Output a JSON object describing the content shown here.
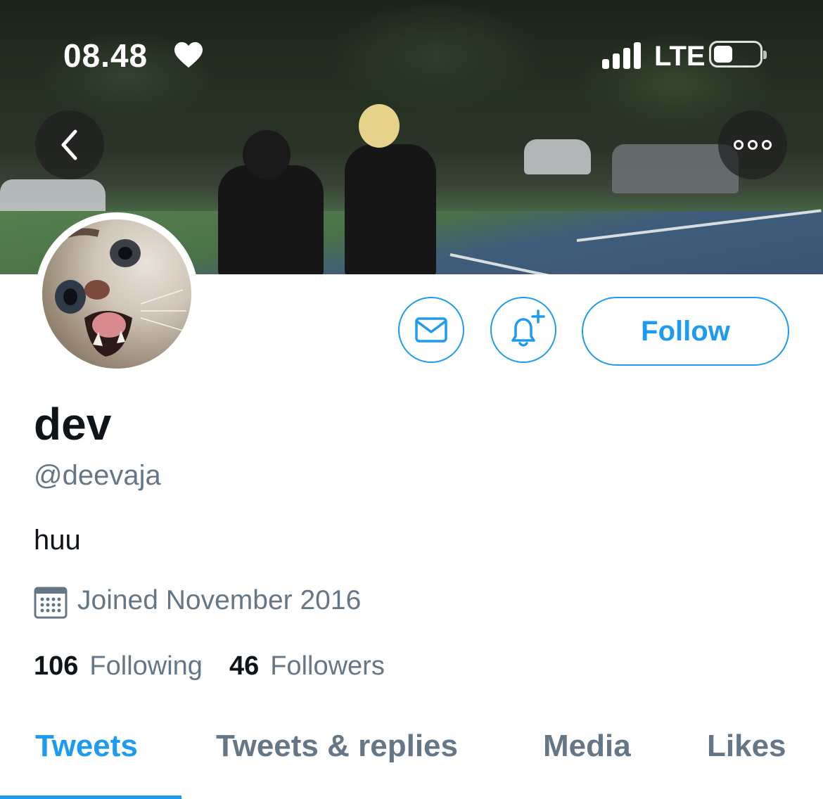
{
  "status_bar": {
    "time": "08.48",
    "network": "LTE"
  },
  "profile": {
    "display_name": "dev",
    "handle": "@deevaja",
    "bio": "huu",
    "joined": "Joined November 2016",
    "following_count": "106",
    "following_label": "Following",
    "followers_count": "46",
    "followers_label": "Followers"
  },
  "actions": {
    "follow_label": "Follow"
  },
  "tabs": [
    {
      "label": "Tweets"
    },
    {
      "label": "Tweets & replies"
    },
    {
      "label": "Media"
    },
    {
      "label": "Likes"
    }
  ],
  "colors": {
    "accent": "#1d9bf0",
    "secondary_text": "#657786",
    "primary_text": "#0f1419"
  },
  "icons": {
    "back": "chevron-left-icon",
    "more": "ellipsis-icon",
    "mail": "mail-icon",
    "notify": "bell-plus-icon",
    "calendar": "calendar-icon",
    "heart": "heart-icon"
  }
}
